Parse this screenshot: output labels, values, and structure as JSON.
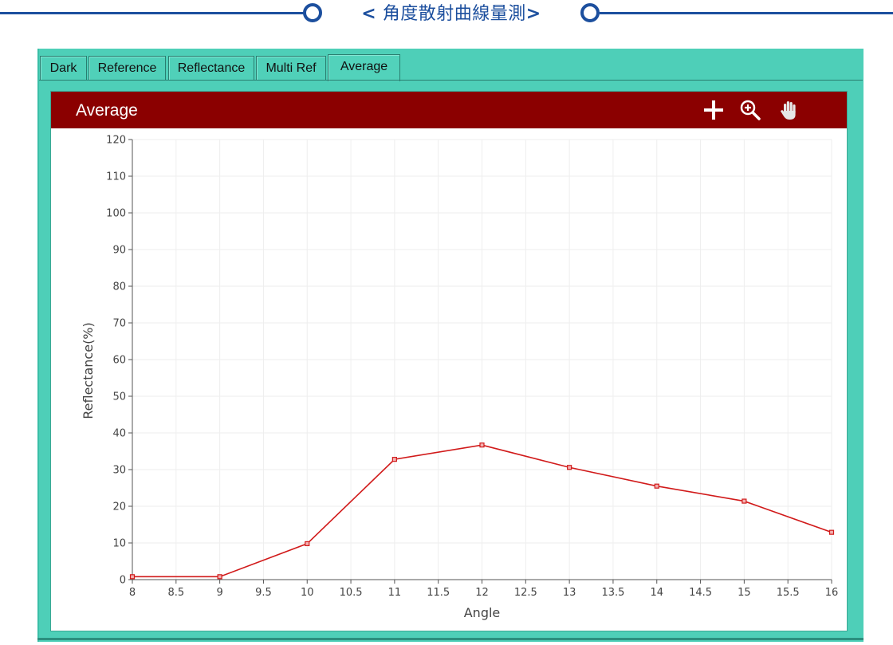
{
  "banner": {
    "title_prefix": "<",
    "title": "角度散射曲線量測",
    "title_suffix": ">",
    "color": "#1c4f9e"
  },
  "tabs": [
    {
      "label": "Dark",
      "active": false
    },
    {
      "label": "Reference",
      "active": false
    },
    {
      "label": "Reflectance",
      "active": false
    },
    {
      "label": "Multi Ref",
      "active": false
    },
    {
      "label": "Average",
      "active": true
    }
  ],
  "panel": {
    "title": "Average",
    "header_color": "#8b0000",
    "tools": [
      "crosshair-icon",
      "zoom-in-icon",
      "hand-pan-icon"
    ]
  },
  "colors": {
    "frame": "#4ecfb8",
    "series": "#d11a1a"
  },
  "chart_data": {
    "type": "line",
    "xlabel": "Angle",
    "ylabel": "Reflectance(%)",
    "xlim": [
      8,
      16
    ],
    "ylim": [
      0,
      120
    ],
    "xticks": [
      8,
      8.5,
      9,
      9.5,
      10,
      10.5,
      11,
      11.5,
      12,
      12.5,
      13,
      13.5,
      14,
      14.5,
      15,
      15.5,
      16
    ],
    "xtick_labels": [
      "8",
      "8.5",
      "9",
      "9.5",
      "10",
      "10.5",
      "11",
      "11.5",
      "12",
      "12.5",
      "13",
      "13.5",
      "14",
      "14.5",
      "15",
      "15.5",
      "16"
    ],
    "yticks": [
      0,
      10,
      20,
      30,
      40,
      50,
      60,
      70,
      80,
      90,
      100,
      110,
      120
    ],
    "ytick_labels": [
      "0",
      "10",
      "20",
      "30",
      "40",
      "50",
      "60",
      "70",
      "80",
      "90",
      "100",
      "110",
      "120"
    ],
    "grid": true,
    "legend": "none",
    "series": [
      {
        "x": [
          8,
          9,
          10,
          11,
          12,
          13,
          14,
          15,
          16
        ],
        "y": [
          0.8,
          0.8,
          9.8,
          32.8,
          36.7,
          30.6,
          25.5,
          21.4,
          12.9
        ],
        "color": "#d11a1a",
        "marker": "square"
      }
    ]
  }
}
